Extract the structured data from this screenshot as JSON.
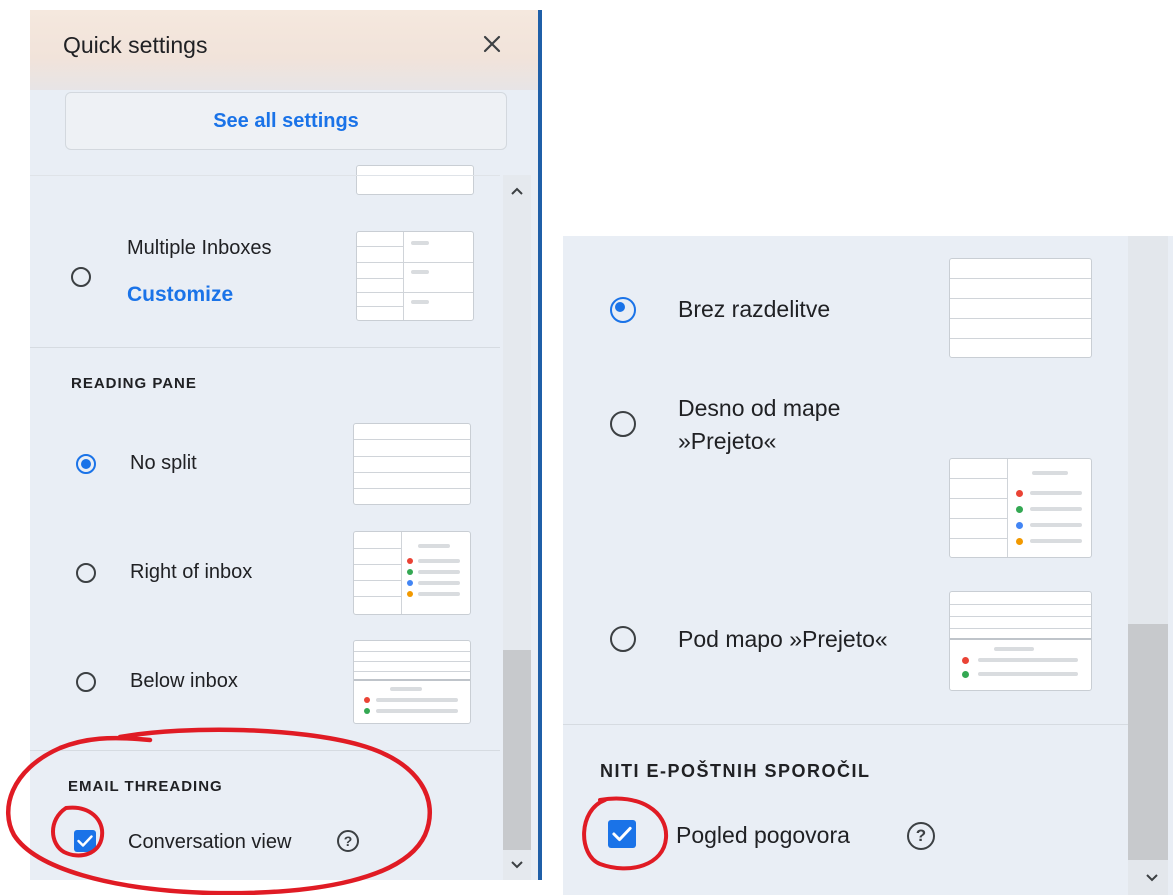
{
  "left": {
    "title": "Quick settings",
    "close_icon": "close-icon",
    "see_all": "See all settings",
    "multiple_inboxes": {
      "label": "Multiple Inboxes",
      "link": "Customize"
    },
    "reading_pane": {
      "heading": "READING PANE",
      "options": [
        {
          "label": "No split",
          "selected": true
        },
        {
          "label": "Right of inbox",
          "selected": false
        },
        {
          "label": "Below inbox",
          "selected": false
        }
      ]
    },
    "threading": {
      "heading": "EMAIL THREADING",
      "checkbox_label": "Conversation view",
      "checked": true
    }
  },
  "right": {
    "reading_pane": {
      "options": [
        {
          "label": "Brez razdelitve",
          "selected": true
        },
        {
          "label": "Desno od mape »Prejeto«",
          "selected": false
        },
        {
          "label": "Pod mapo »Prejeto«",
          "selected": false
        }
      ]
    },
    "threading": {
      "heading": "NITI E-POŠTNIH SPOROČIL",
      "checkbox_label": "Pogled pogovora",
      "checked": true
    }
  },
  "colors": {
    "accent": "#1a73e8",
    "panel_bg": "#e9eef5",
    "annotation": "#e01b24",
    "dot_red": "#ea4335",
    "dot_green": "#34a853",
    "dot_blue": "#4285f4",
    "dot_yellow": "#f29900"
  }
}
